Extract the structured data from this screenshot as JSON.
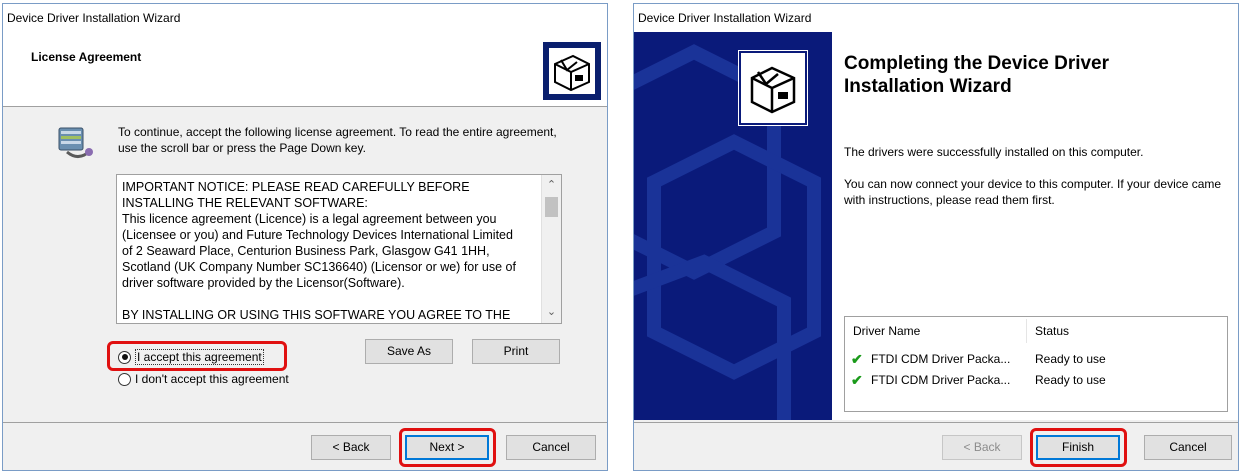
{
  "license_dialog": {
    "window_title": "Device Driver Installation Wizard",
    "header_title": "License Agreement",
    "intro_text": "To continue, accept the following license agreement. To read the entire agreement, use the scroll bar or press the Page Down key.",
    "license_text": "IMPORTANT NOTICE: PLEASE READ CAREFULLY BEFORE\nINSTALLING THE RELEVANT SOFTWARE:\nThis licence agreement (Licence) is a legal agreement between you\n(Licensee or you) and Future Technology Devices International Limited\nof 2 Seaward Place, Centurion Business Park, Glasgow G41 1HH,\nScotland (UK Company Number SC136640) (Licensor or we) for use of\ndriver software provided by the Licensor(Software).\n\nBY INSTALLING OR USING THIS SOFTWARE YOU AGREE TO THE",
    "radio_accept": "I accept this agreement",
    "radio_decline": "I don't accept this agreement",
    "accept_selected": true,
    "save_as_label": "Save As",
    "print_label": "Print",
    "back_label": "< Back",
    "next_label": "Next >",
    "cancel_label": "Cancel",
    "highlight_color": "#e01010"
  },
  "complete_dialog": {
    "window_title": "Device Driver Installation Wizard",
    "title": "Completing the Device Driver Installation Wizard",
    "success_text": "The drivers were successfully installed on this computer.",
    "connect_text": "You can now connect your device to this computer. If your device came with instructions, please read them first.",
    "columns": [
      "Driver Name",
      "Status"
    ],
    "rows": [
      {
        "name": "FTDI CDM Driver Packa...",
        "status": "Ready to use"
      },
      {
        "name": "FTDI CDM Driver Packa...",
        "status": "Ready to use"
      }
    ],
    "back_label": "< Back",
    "finish_label": "Finish",
    "cancel_label": "Cancel",
    "banner_color": "#0a1a7a"
  }
}
